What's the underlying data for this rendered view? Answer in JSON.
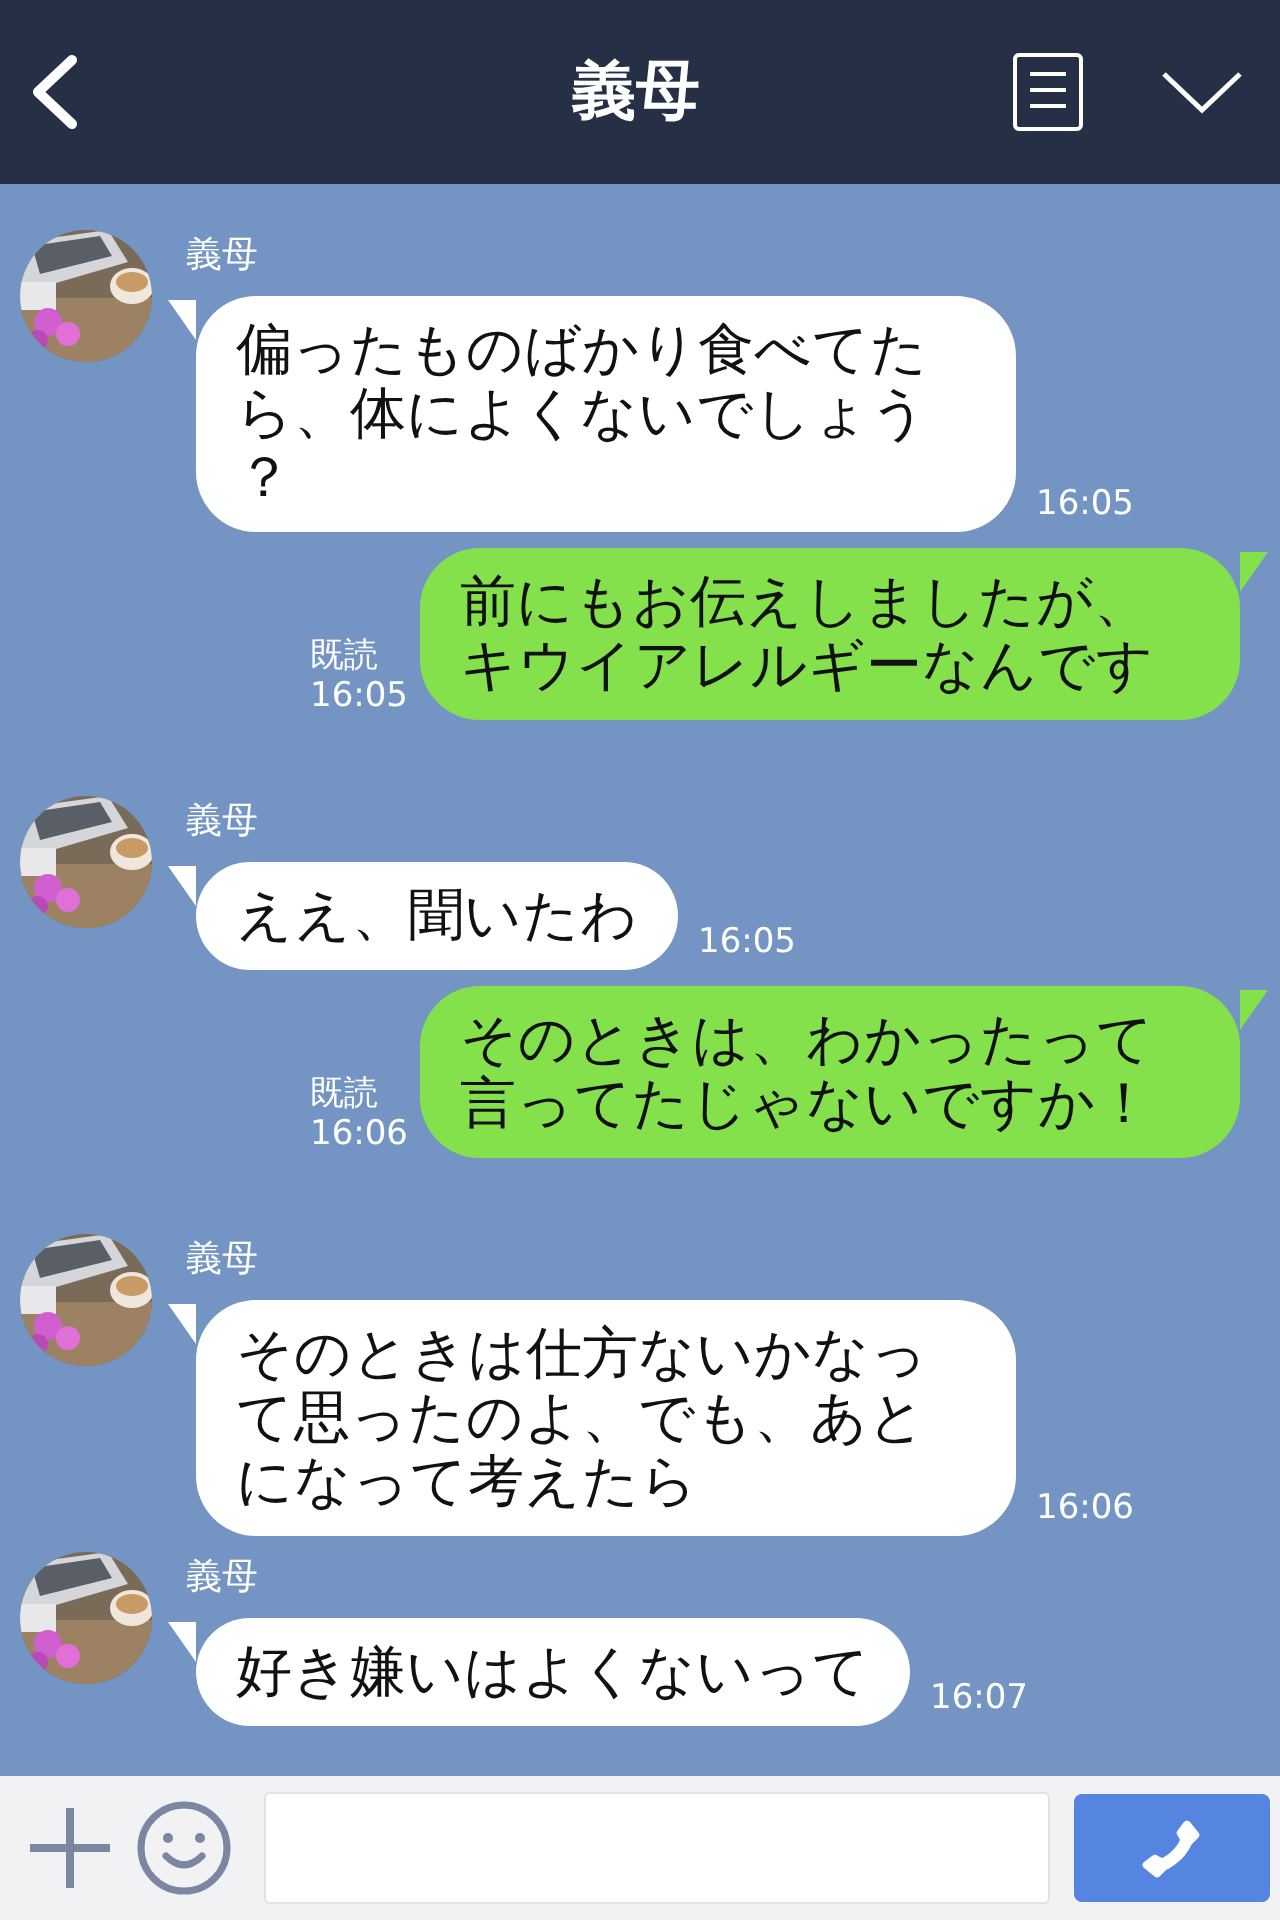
{
  "header": {
    "title": "義母"
  },
  "messages": [
    {
      "kind": "incoming",
      "sender": "義母",
      "text": "偏ったものばかり食べてたら、体によくないでしょう？",
      "time": "16:05"
    },
    {
      "kind": "outgoing",
      "read": "既読",
      "text": "前にもお伝えしましたが、キウイアレルギーなんです",
      "time": "16:05"
    },
    {
      "kind": "incoming",
      "sender": "義母",
      "text": "ええ、聞いたわ",
      "time": "16:05"
    },
    {
      "kind": "outgoing",
      "read": "既読",
      "text": "そのときは、わかったって言ってたじゃないですか！",
      "time": "16:06"
    },
    {
      "kind": "incoming",
      "sender": "義母",
      "text": "そのときは仕方ないかなって思ったのよ、でも、あとになって考えたら",
      "time": "16:06"
    },
    {
      "kind": "incoming",
      "sender": "義母",
      "text": "好き嫌いはよくないって",
      "time": "16:07"
    }
  ]
}
